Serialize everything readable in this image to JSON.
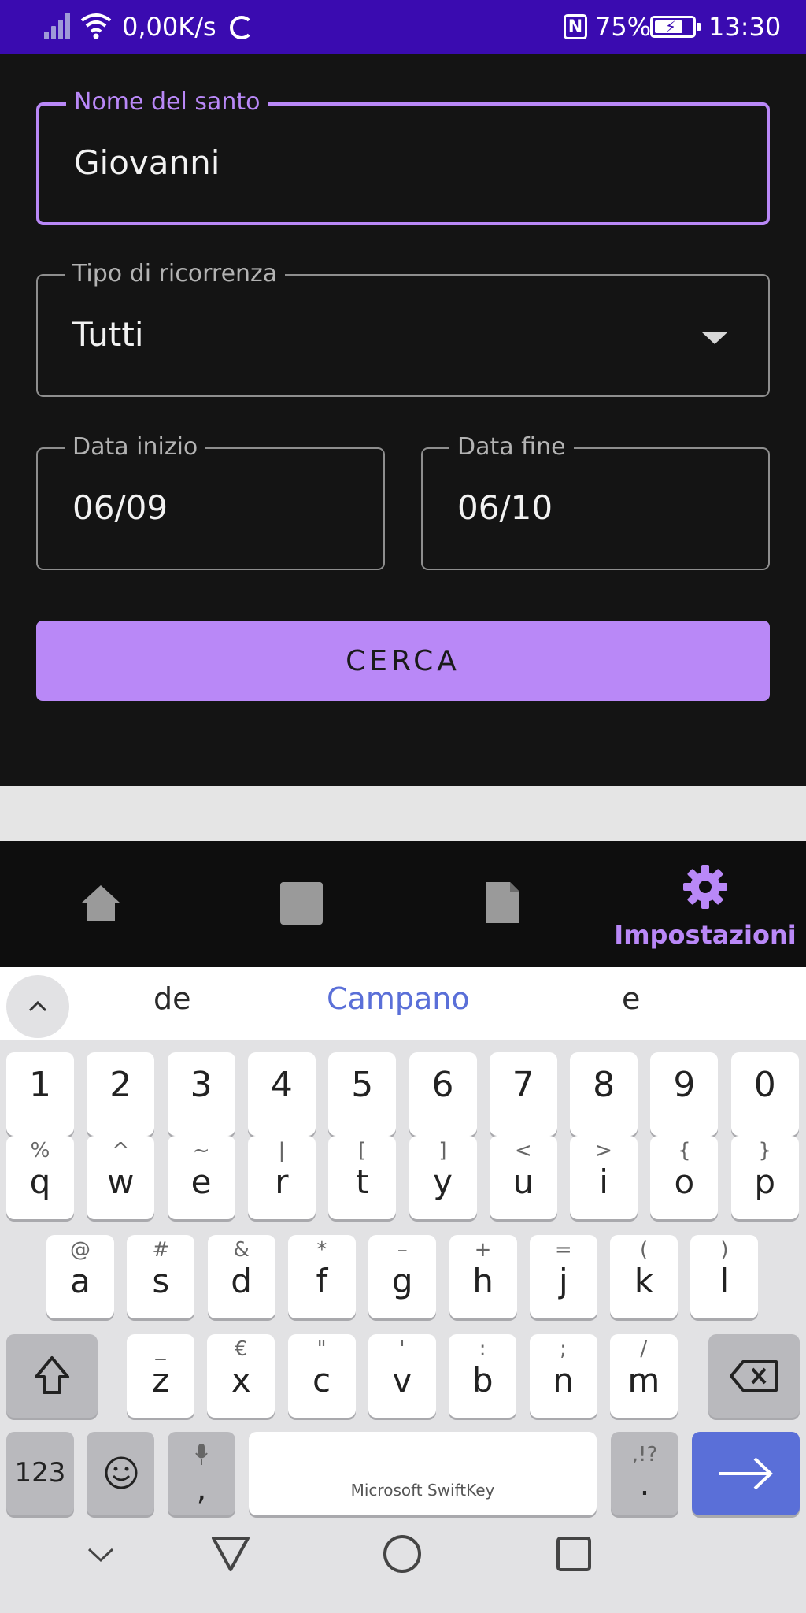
{
  "status_bar": {
    "network_speed": "0,00K/s",
    "battery": "75%",
    "battery_level": 0.75,
    "time": "13:30",
    "nfc_label": "N"
  },
  "form": {
    "saint_name": {
      "label": "Nome del santo",
      "value": "Giovanni"
    },
    "recurrence": {
      "label": "Tipo di ricorrenza",
      "value": "Tutti"
    },
    "start_date": {
      "label": "Data inizio",
      "value": "06/09"
    },
    "end_date": {
      "label": "Data fine",
      "value": "06/10"
    },
    "search_button": "CERCA"
  },
  "bottom_nav": {
    "items": [
      {
        "icon": "home-icon"
      },
      {
        "icon": "square-icon"
      },
      {
        "icon": "document-icon"
      },
      {
        "icon": "gear-icon",
        "label": "Impostazioni",
        "active": true
      }
    ]
  },
  "keyboard": {
    "suggestions": [
      "de",
      "Campano",
      "e"
    ],
    "number_row": [
      "1",
      "2",
      "3",
      "4",
      "5",
      "6",
      "7",
      "8",
      "9",
      "0"
    ],
    "row1": [
      {
        "k": "q",
        "s": "%"
      },
      {
        "k": "w",
        "s": "^"
      },
      {
        "k": "e",
        "s": "~"
      },
      {
        "k": "r",
        "s": "|"
      },
      {
        "k": "t",
        "s": "["
      },
      {
        "k": "y",
        "s": "]"
      },
      {
        "k": "u",
        "s": "<"
      },
      {
        "k": "i",
        "s": ">"
      },
      {
        "k": "o",
        "s": "{"
      },
      {
        "k": "p",
        "s": "}"
      }
    ],
    "row2": [
      {
        "k": "a",
        "s": "@"
      },
      {
        "k": "s",
        "s": "#"
      },
      {
        "k": "d",
        "s": "&"
      },
      {
        "k": "f",
        "s": "*"
      },
      {
        "k": "g",
        "s": "–"
      },
      {
        "k": "h",
        "s": "+"
      },
      {
        "k": "j",
        "s": "="
      },
      {
        "k": "k",
        "s": "("
      },
      {
        "k": "l",
        "s": ")"
      }
    ],
    "row3": [
      {
        "k": "z",
        "s": "_"
      },
      {
        "k": "x",
        "s": "€"
      },
      {
        "k": "c",
        "s": "\""
      },
      {
        "k": "v",
        "s": "'"
      },
      {
        "k": "b",
        "s": ":"
      },
      {
        "k": "n",
        "s": ";"
      },
      {
        "k": "m",
        "s": "/"
      }
    ],
    "numbers_key": "123",
    "comma_key": ",",
    "period_key": ".",
    "period_secondary": ",!?",
    "space_label": "Microsoft SwiftKey",
    "accent_color": "#5a6fd8"
  },
  "colors": {
    "accent": "#b988f7",
    "status_bar": "#3a0bb0",
    "background": "#141414"
  }
}
